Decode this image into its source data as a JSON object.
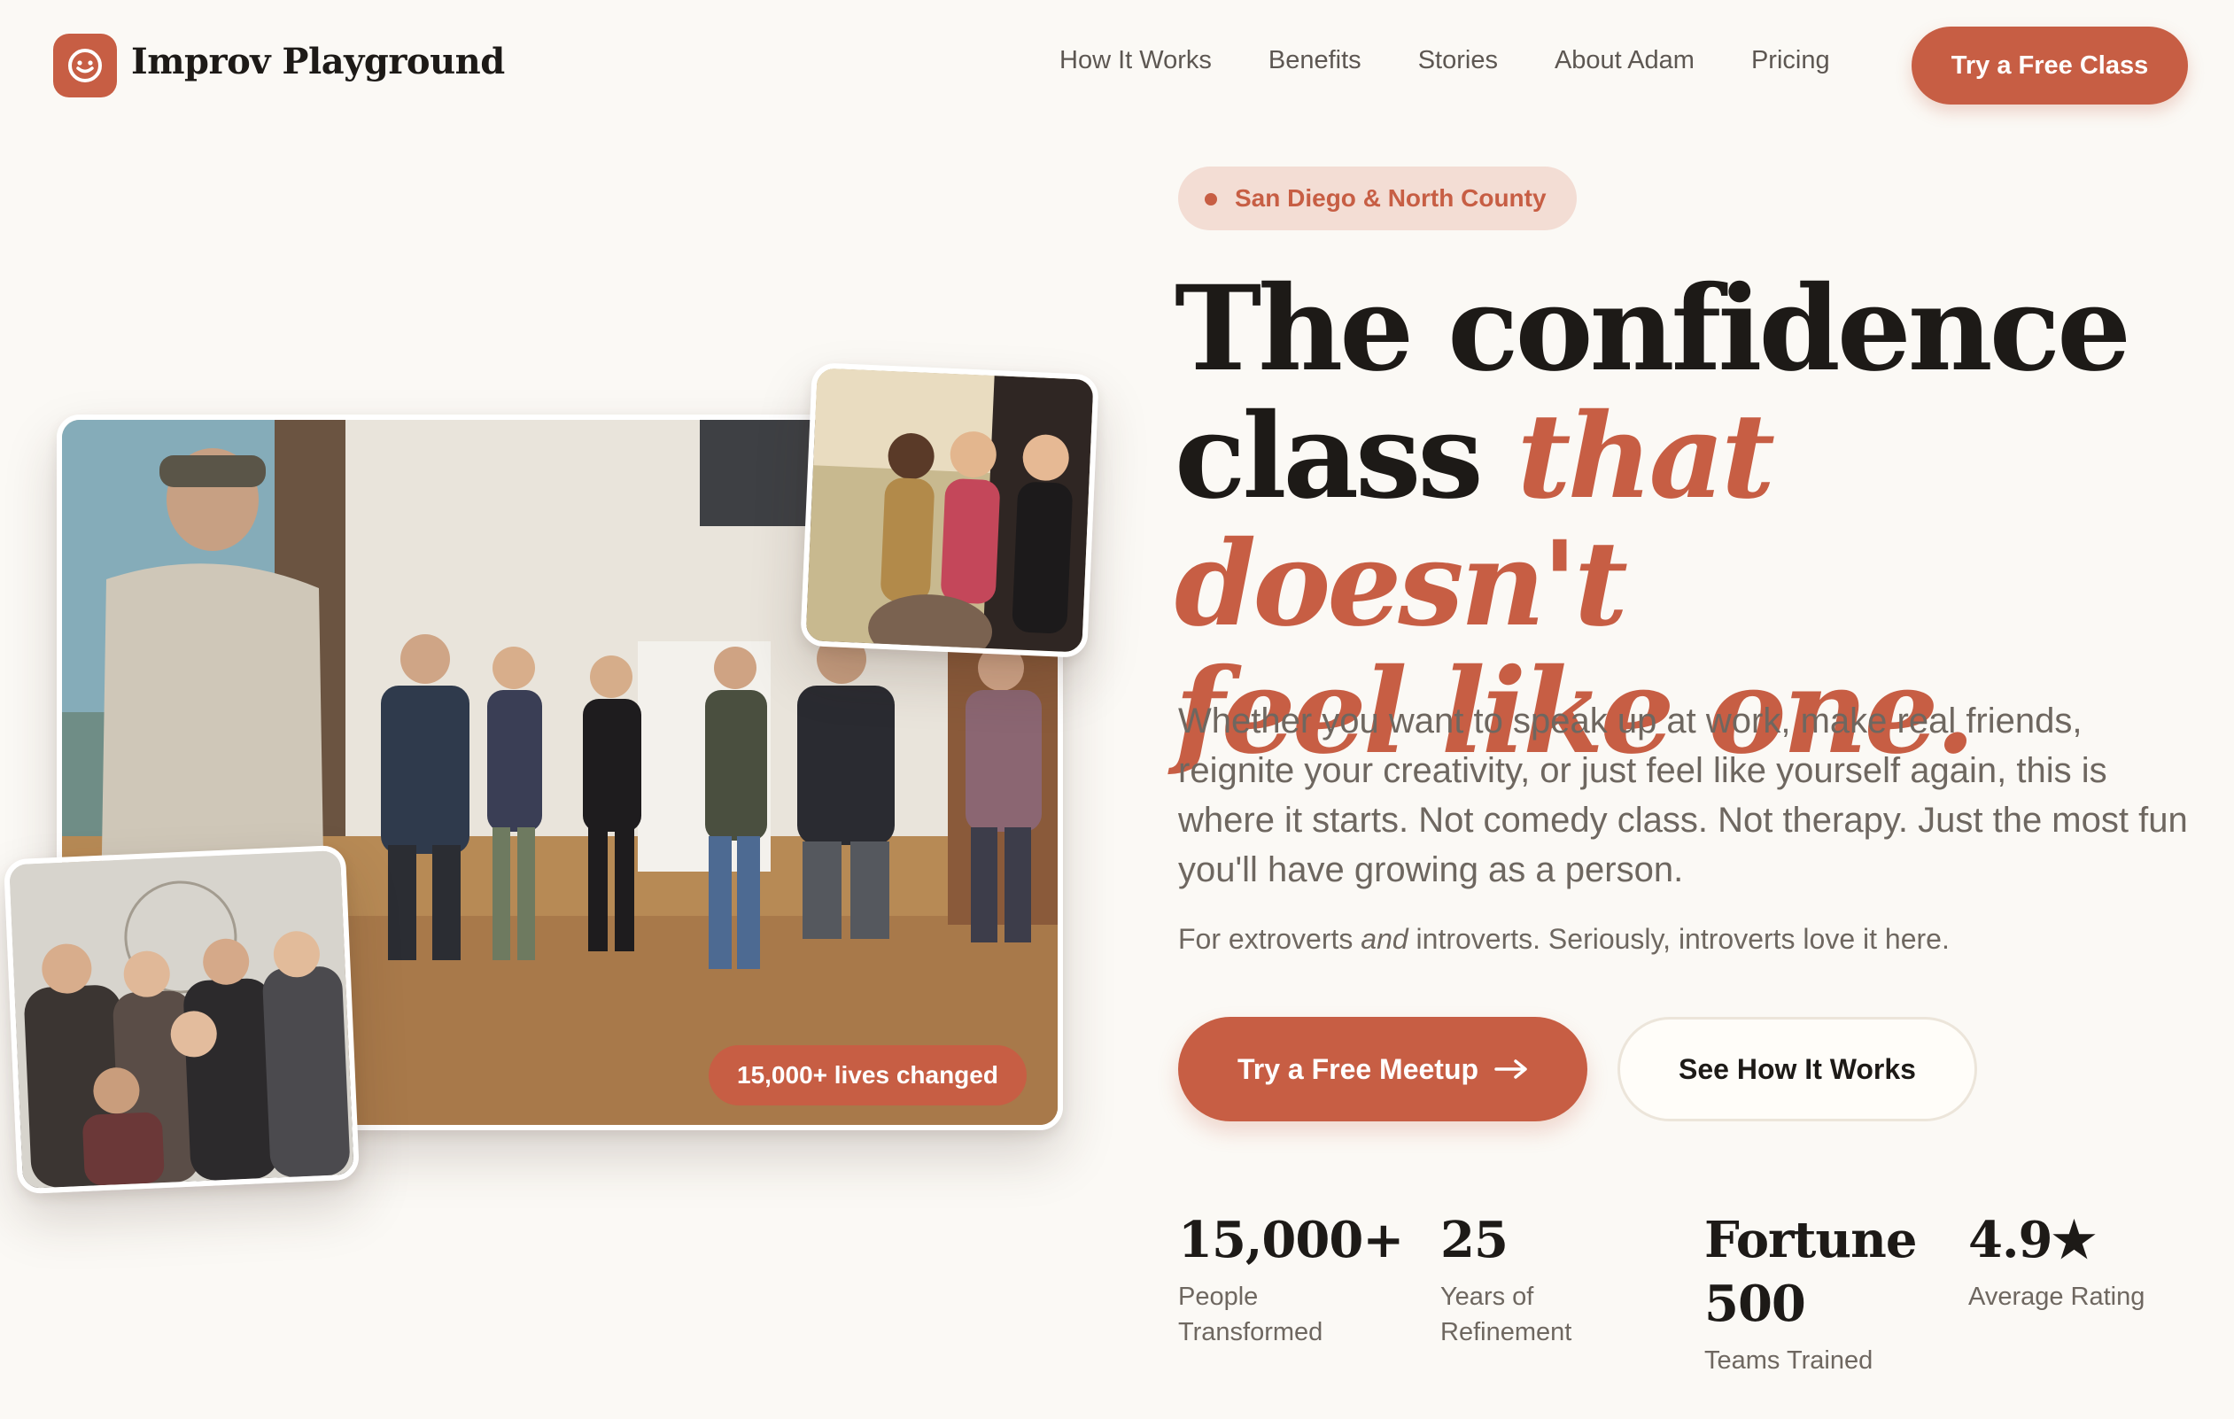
{
  "brand": {
    "name": "Improv Playground",
    "accent_color": "#c75e44"
  },
  "nav": {
    "items": [
      "How It Works",
      "Benefits",
      "Stories",
      "About Adam",
      "Pricing"
    ],
    "cta": "Try a Free Class"
  },
  "hero": {
    "location": "San Diego & North County",
    "headline_line1": "The confidence",
    "headline_line2_plain": "class ",
    "headline_line2_accent": "that doesn't",
    "headline_line3_accent": "feel like one.",
    "lead": "Whether you want to speak up at work, make real friends, reignite your creativity, or just feel like yourself again, this is where it starts. Not comedy class. Not therapy. Just the most fun you'll have growing as a person.",
    "sublead_prefix": "For extroverts ",
    "sublead_italic": "and",
    "sublead_suffix": " introverts. Seriously, introverts love it here.",
    "primary_button": "Try a Free Meetup",
    "primary_button_icon": "arrow-right-icon",
    "secondary_button": "See How It Works",
    "photo_badge": "15,000+ lives changed"
  },
  "stats": [
    {
      "value": "15,000+",
      "label": "People Transformed"
    },
    {
      "value": "25",
      "label": "Years of Refinement"
    },
    {
      "value": "Fortune 500",
      "label": "Teams Trained"
    },
    {
      "value": "4.9★",
      "label": "Average Rating"
    }
  ]
}
